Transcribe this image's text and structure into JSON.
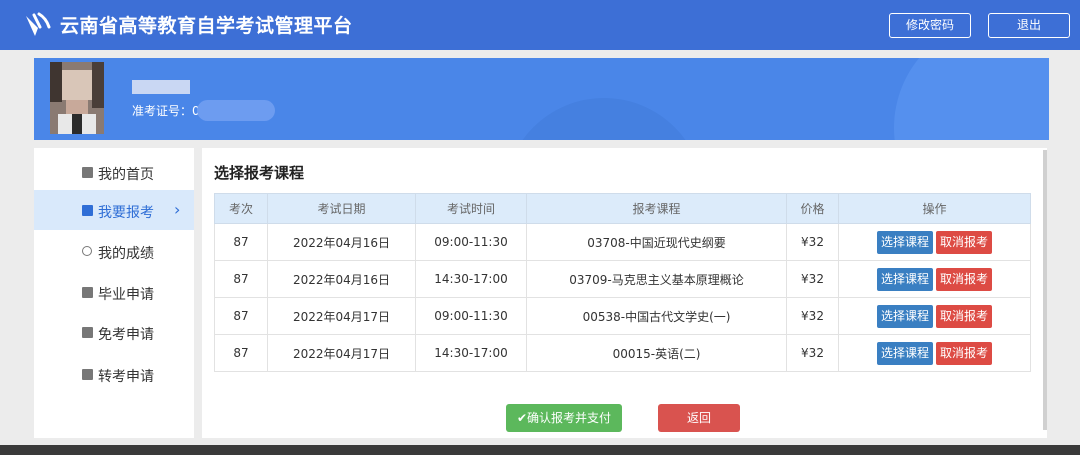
{
  "header": {
    "title": "云南省高等教育自学考试管理平台",
    "buttons": {
      "change_password": "修改密码",
      "logout": "退出"
    },
    "colors": {
      "bar": "#3d6fd6",
      "banner": "#4a86e8"
    }
  },
  "profile": {
    "name": "",
    "exam_no_label": "准考证号：",
    "exam_no_prefix": "0",
    "avatar": "avatar-photo"
  },
  "sidebar": {
    "items": [
      {
        "label": "我的首页",
        "icon": "home-icon",
        "active": false
      },
      {
        "label": "我要报考",
        "icon": "register-icon",
        "active": true
      },
      {
        "label": "我的成绩",
        "icon": "person-icon",
        "active": false
      },
      {
        "label": "毕业申请",
        "icon": "graduation-icon",
        "active": false
      },
      {
        "label": "免考申请",
        "icon": "exemption-icon",
        "active": false
      },
      {
        "label": "转考申请",
        "icon": "transfer-icon",
        "active": false
      }
    ],
    "active_chevron": "›"
  },
  "main": {
    "section_title": "选择报考课程",
    "table": {
      "headers": [
        "考次",
        "考试日期",
        "考试时间",
        "报考课程",
        "价格",
        "操作"
      ],
      "rows": [
        {
          "session": "87",
          "date": "2022年04月16日",
          "time": "09:00-11:30",
          "course": "03708-中国近现代史纲要",
          "price": "¥32"
        },
        {
          "session": "87",
          "date": "2022年04月16日",
          "time": "14:30-17:00",
          "course": "03709-马克思主义基本原理概论",
          "price": "¥32"
        },
        {
          "session": "87",
          "date": "2022年04月17日",
          "time": "09:00-11:30",
          "course": "00538-中国古代文学史(一)",
          "price": "¥32"
        },
        {
          "session": "87",
          "date": "2022年04月17日",
          "time": "14:30-17:00",
          "course": "00015-英语(二)",
          "price": "¥32"
        }
      ],
      "row_actions": {
        "choose": "选择课程",
        "cancel": "取消报考"
      }
    },
    "confirm_button": "✔确认报考并支付",
    "back_button": "返回"
  }
}
